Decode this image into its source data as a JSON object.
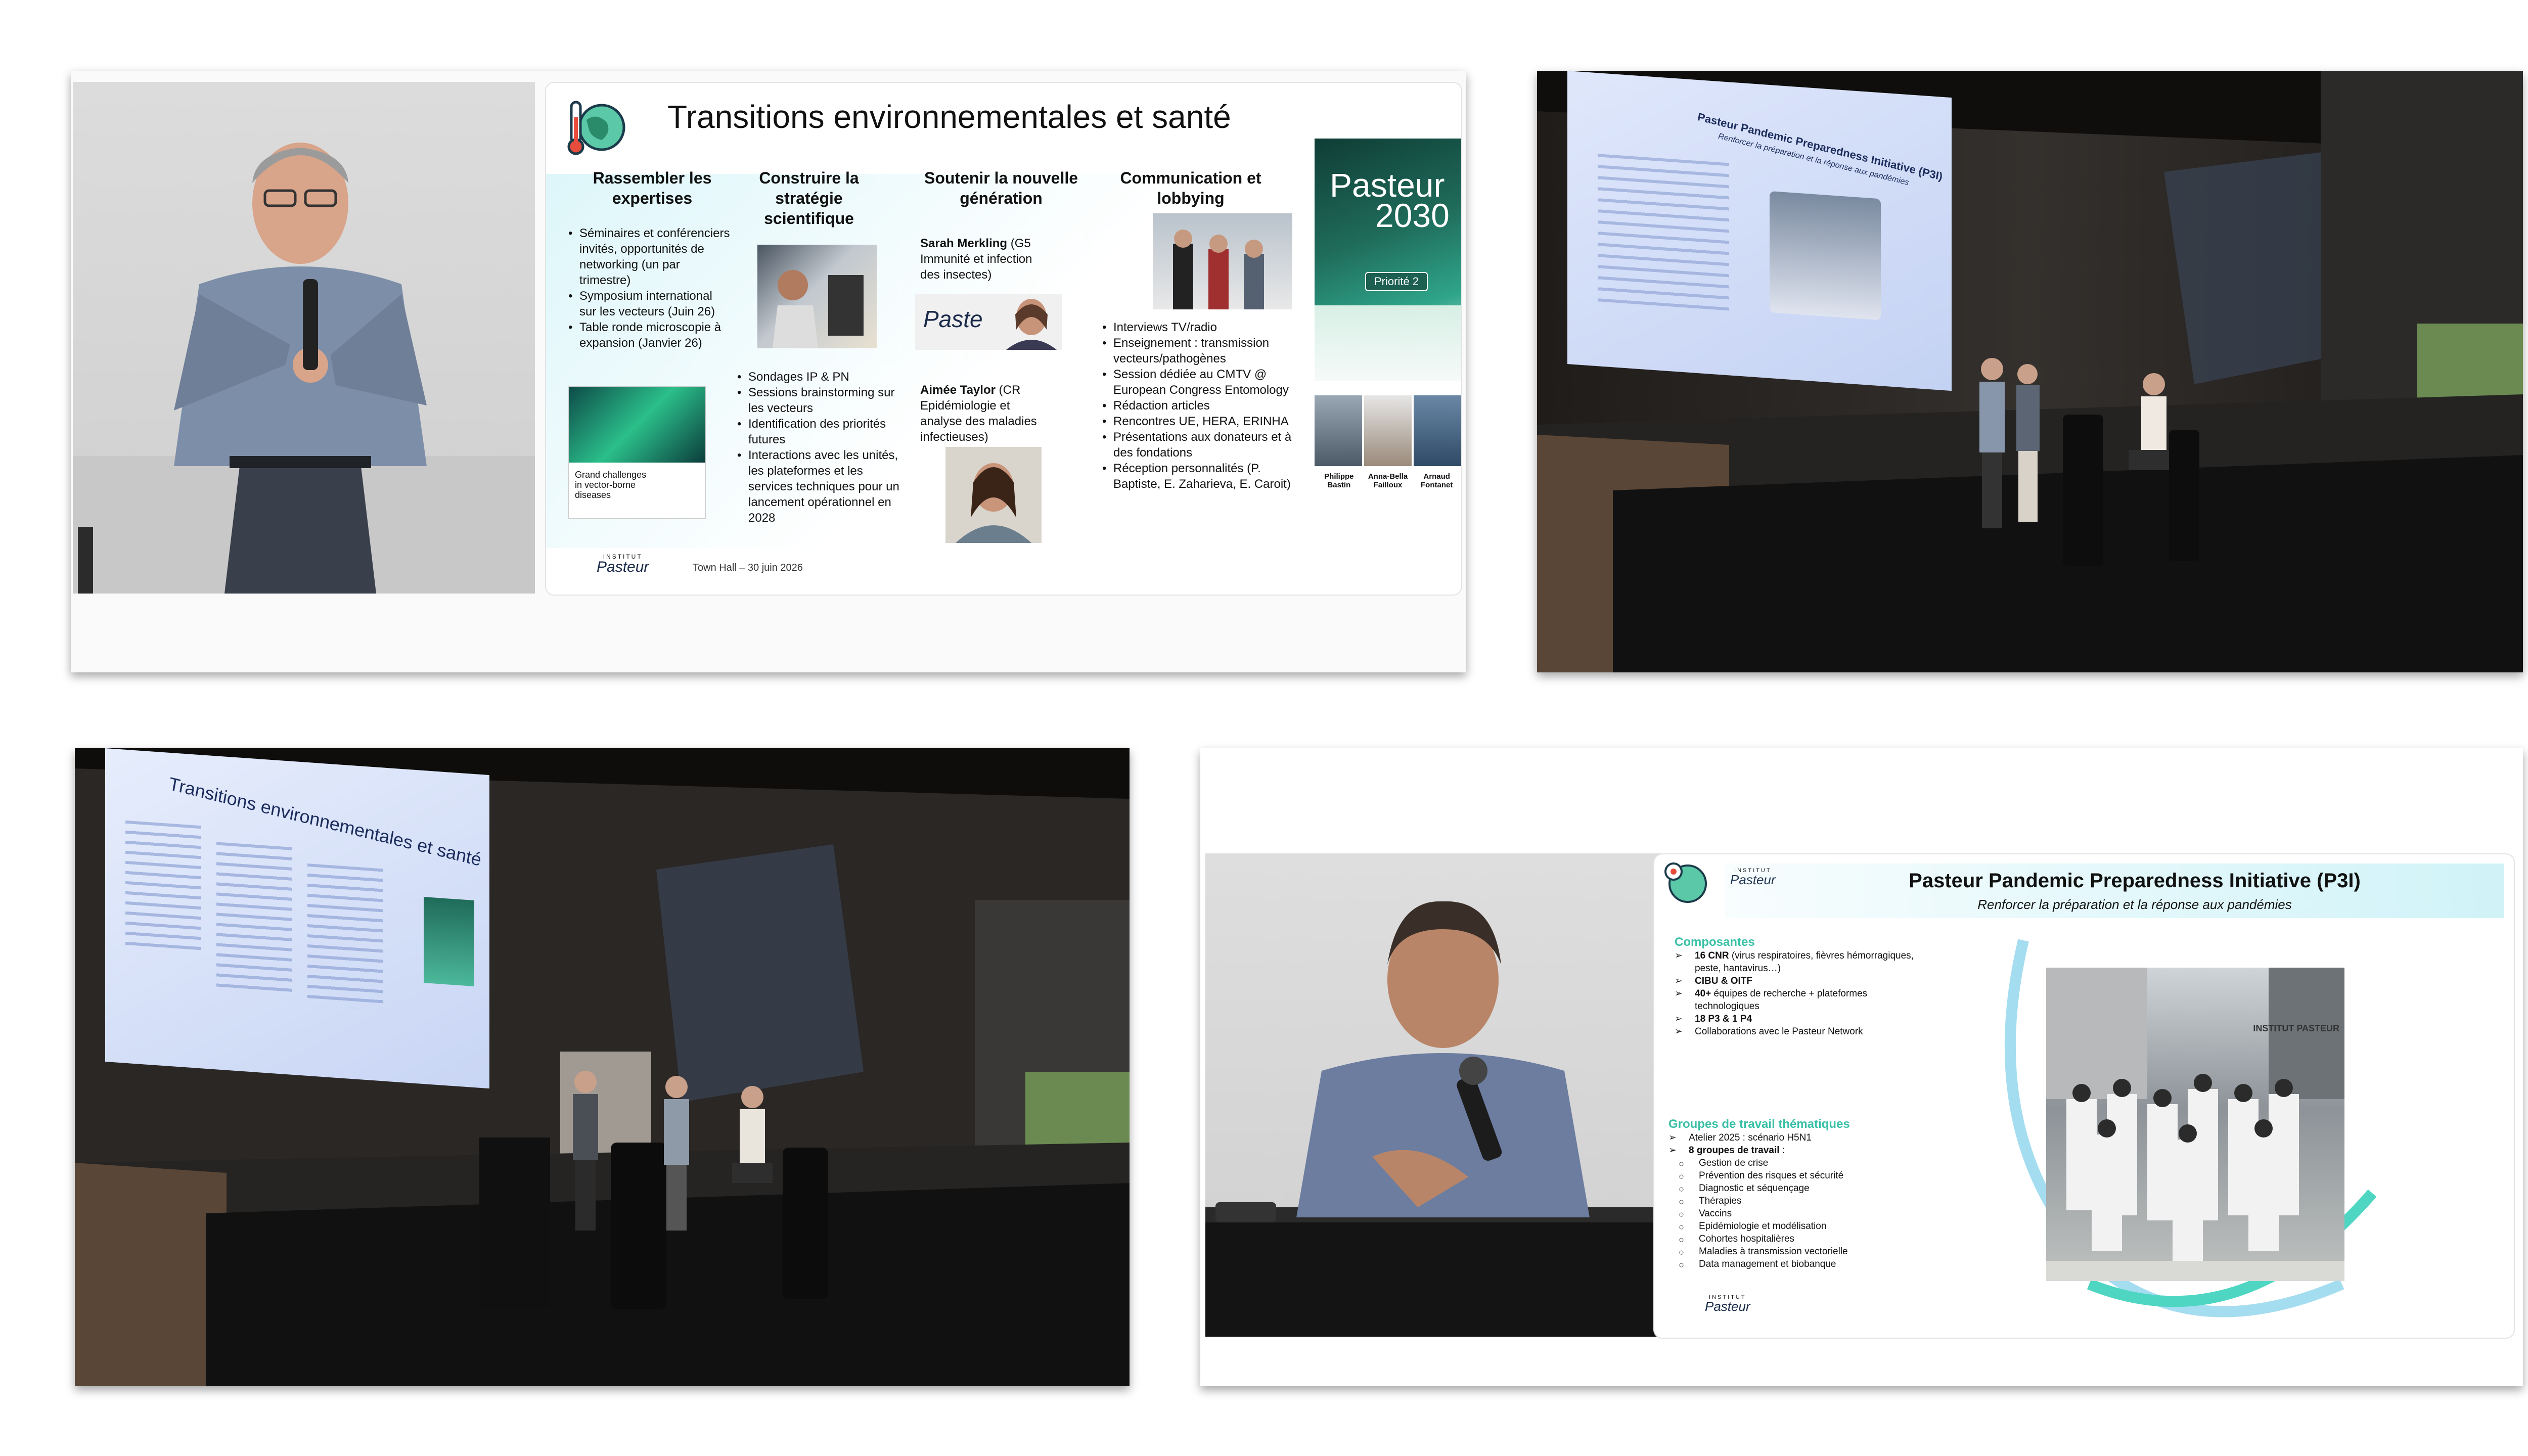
{
  "panel_a": {
    "slide": {
      "title": "Transitions environnementales et santé",
      "col1": {
        "header": "Rassembler les expertises",
        "bullets": [
          "Séminaires et conférenciers invités, opportunités de networking (un par trimestre)",
          "Symposium international sur les vecteurs (Juin 26)",
          "Table ronde microscopie à expansion (Janvier 26)"
        ],
        "book_label": "Grand challenges in vector-borne diseases"
      },
      "col2": {
        "header": "Construire la stratégie scientifique",
        "bullets": [
          "Sondages IP & PN",
          "Sessions brainstorming sur les vecteurs",
          "Identification des priorités futures",
          "Interactions avec les unités, les plateformes et les services techniques pour un lancement opérationnel en 2028"
        ]
      },
      "col3": {
        "header": "Soutenir la nouvelle génération",
        "person1_name": "Sarah Merkling",
        "person1_desc": "(G5 Immunité et infection des insectes)",
        "logo_snippet": "Paste",
        "person2_name": "Aimée Taylor",
        "person2_desc": "(CR Epidémiologie et analyse des maladies infectieuses)"
      },
      "col4": {
        "header": "Communication et lobbying",
        "bullets": [
          "Interviews TV/radio",
          "Enseignement : transmission vecteurs/pathogènes",
          "Session dédiée au CMTV @ European Congress Entomology",
          "Rédaction articles",
          "Rencontres UE, HERA, ERINHA",
          "Présentations aux donateurs et à des fondations",
          "Réception personnalités (P. Baptiste, E. Zaharieva, E. Caroit)"
        ]
      },
      "cover_title_1": "Pasteur",
      "cover_title_2": "2030",
      "cover_badge": "Priorité 2",
      "people": [
        "Philippe Bastin",
        "Anna-Bella Failloux",
        "Arnaud Fontanet"
      ],
      "logo_top": "INSTITUT",
      "logo_main": "Pasteur",
      "footer": "Town Hall – 30 juin 2026"
    }
  },
  "panel_b": {
    "screen_title": "Pasteur Pandemic Preparedness Initiative (P3I)",
    "screen_subtitle": "Renforcer la préparation et la réponse aux pandémies"
  },
  "panel_c": {
    "screen_title": "Transitions environnementales et santé"
  },
  "panel_d": {
    "slide": {
      "logo_top": "INSTITUT",
      "logo_main": "Pasteur",
      "title": "Pasteur Pandemic Preparedness Initiative (P3I)",
      "subtitle": "Renforcer la préparation et la réponse aux pandémies",
      "section1_title": "Composantes",
      "section1_items": [
        {
          "bold": "16 CNR",
          "rest": " (virus respiratoires, fièvres hémorragiques, peste, hantavirus…)"
        },
        {
          "bold": "CIBU & OITF",
          "rest": ""
        },
        {
          "bold": "40+",
          "rest": " équipes de recherche + plateformes technologiques"
        },
        {
          "bold": "18 P3 & 1 P4",
          "rest": ""
        },
        {
          "bold": "",
          "rest": "Collaborations avec le Pasteur Network"
        }
      ],
      "section2_title": "Groupes de travail thématiques",
      "section2_items": [
        {
          "bold": "",
          "rest": "Atelier 2025 : scénario H5N1"
        },
        {
          "bold": "8 groupes de travail",
          "rest": " :"
        }
      ],
      "section2_subitems": [
        "Gestion de crise",
        "Prévention des risques et sécurité",
        "Diagnostic et séquençage",
        "Thérapies",
        "Vaccins",
        "Epidémiologie et modélisation",
        "Cohortes hospitalières",
        "Maladies à transmission vectorielle",
        "Data management et biobanque"
      ],
      "photo_sign": "INSTITUT PASTEUR"
    }
  },
  "colors": {
    "accent_teal": "#4fd6c2",
    "accent_cyan": "#69c6e6",
    "section_title": "#39c0a6",
    "stage_dark": "#1a1715",
    "cover_green": "#1f6b5a"
  }
}
